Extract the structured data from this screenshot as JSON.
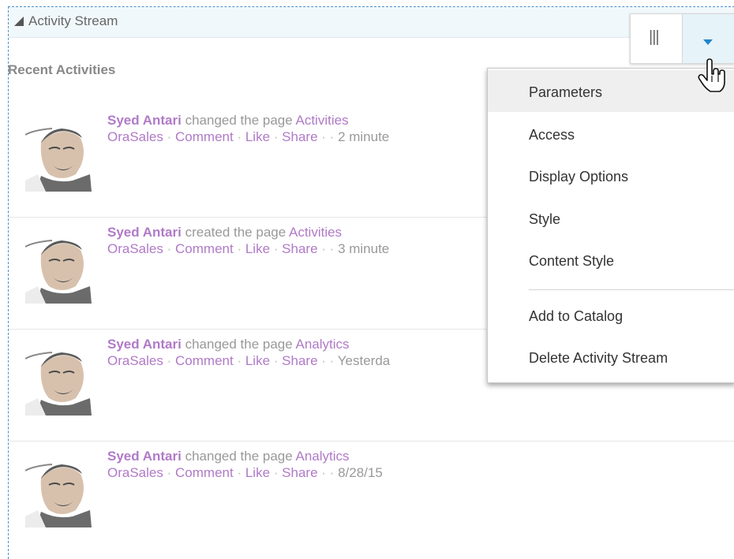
{
  "header": {
    "title": "Activity Stream"
  },
  "section": {
    "title": "Recent Activities"
  },
  "activities": [
    {
      "author": "Syed Antari",
      "action": "changed the page",
      "target": "Activities",
      "app": "OraSales",
      "comment": "Comment",
      "like": "Like",
      "share": "Share",
      "time": "2 minute"
    },
    {
      "author": "Syed Antari",
      "action": "created the page",
      "target": "Activities",
      "app": "OraSales",
      "comment": "Comment",
      "like": "Like",
      "share": "Share",
      "time": "3 minute"
    },
    {
      "author": "Syed Antari",
      "action": "changed the page",
      "target": "Analytics",
      "app": "OraSales",
      "comment": "Comment",
      "like": "Like",
      "share": "Share",
      "time": "Yesterda"
    },
    {
      "author": "Syed Antari",
      "action": "changed the page",
      "target": "Analytics",
      "app": "OraSales",
      "comment": "Comment",
      "like": "Like",
      "share": "Share",
      "time": "8/28/15"
    }
  ],
  "menu": {
    "items": [
      {
        "label": "Parameters"
      },
      {
        "label": "Access"
      },
      {
        "label": "Display Options"
      },
      {
        "label": "Style"
      },
      {
        "label": "Content Style"
      },
      {
        "label": "Add to Catalog"
      },
      {
        "label": "Delete Activity Stream"
      }
    ]
  },
  "toolbar": {
    "columns_icon": "columns-icon",
    "dropdown_icon": "dropdown-arrow-icon"
  },
  "colors": {
    "link": "#b07ac7",
    "accent": "#1f86c9",
    "frame": "#4a90c8"
  }
}
